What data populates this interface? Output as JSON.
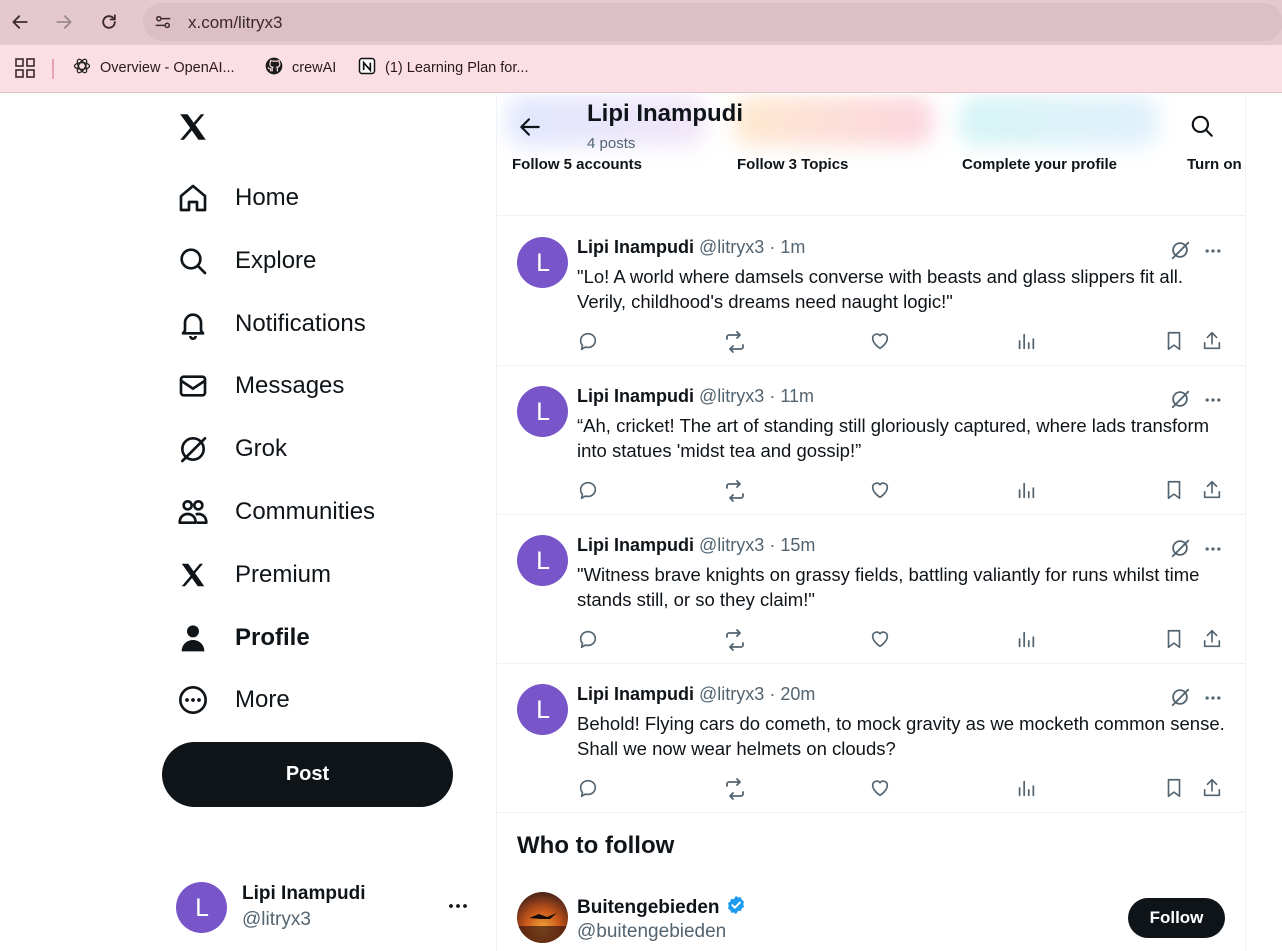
{
  "browser": {
    "url": "x.com/litryx3",
    "bookmarks": [
      {
        "label": "Overview - OpenAI...",
        "icon": "openai-icon"
      },
      {
        "label": "crewAI",
        "icon": "github-icon"
      },
      {
        "label": "(1) Learning Plan for...",
        "icon": "notion-icon"
      }
    ]
  },
  "nav": {
    "items": [
      {
        "label": "Home",
        "icon": "home-icon"
      },
      {
        "label": "Explore",
        "icon": "search-icon"
      },
      {
        "label": "Notifications",
        "icon": "bell-icon"
      },
      {
        "label": "Messages",
        "icon": "envelope-icon"
      },
      {
        "label": "Grok",
        "icon": "grok-icon"
      },
      {
        "label": "Communities",
        "icon": "communities-icon"
      },
      {
        "label": "Premium",
        "icon": "x-icon"
      },
      {
        "label": "Profile",
        "icon": "person-icon"
      },
      {
        "label": "More",
        "icon": "more-circle-icon"
      }
    ],
    "post_label": "Post"
  },
  "account": {
    "initial": "L",
    "name": "Lipi Inampudi",
    "handle": "@litryx3"
  },
  "header": {
    "title": "Lipi Inampudi",
    "subtitle": "4 posts"
  },
  "onboarding": [
    "Follow 5 accounts",
    "Follow 3 Topics",
    "Complete your profile",
    "Turn on"
  ],
  "tweets": [
    {
      "initial": "L",
      "name": "Lipi Inampudi",
      "handle": "@litryx3",
      "sep": "·",
      "time": "1m",
      "text": "\"Lo! A world where damsels converse with beasts and glass slippers fit all. Verily, childhood's dreams need naught logic!\""
    },
    {
      "initial": "L",
      "name": "Lipi Inampudi",
      "handle": "@litryx3",
      "sep": "·",
      "time": "11m",
      "text": "“Ah, cricket! The art of standing still gloriously captured, where lads transform into statues 'midst tea and gossip!”"
    },
    {
      "initial": "L",
      "name": "Lipi Inampudi",
      "handle": "@litryx3",
      "sep": "·",
      "time": "15m",
      "text": "\"Witness brave knights on grassy fields, battling valiantly for runs whilst time stands still, or so they claim!\""
    },
    {
      "initial": "L",
      "name": "Lipi Inampudi",
      "handle": "@litryx3",
      "sep": "·",
      "time": "20m",
      "text": "Behold! Flying cars do cometh, to mock gravity as we mocketh common sense. Shall we now wear helmets on clouds?"
    }
  ],
  "who_to_follow": {
    "title": "Who to follow",
    "items": [
      {
        "name": "Buitengebieden",
        "handle": "@buitengebieden",
        "verified": true,
        "button": "Follow"
      }
    ]
  },
  "colors": {
    "browser_bar": "#e6c9cf",
    "bookmarks_bar": "#fcdfe4",
    "avatar": "#7856c9",
    "text_primary": "#0f1419",
    "text_secondary": "#536471",
    "verified_badge": "#1d9bf0"
  }
}
